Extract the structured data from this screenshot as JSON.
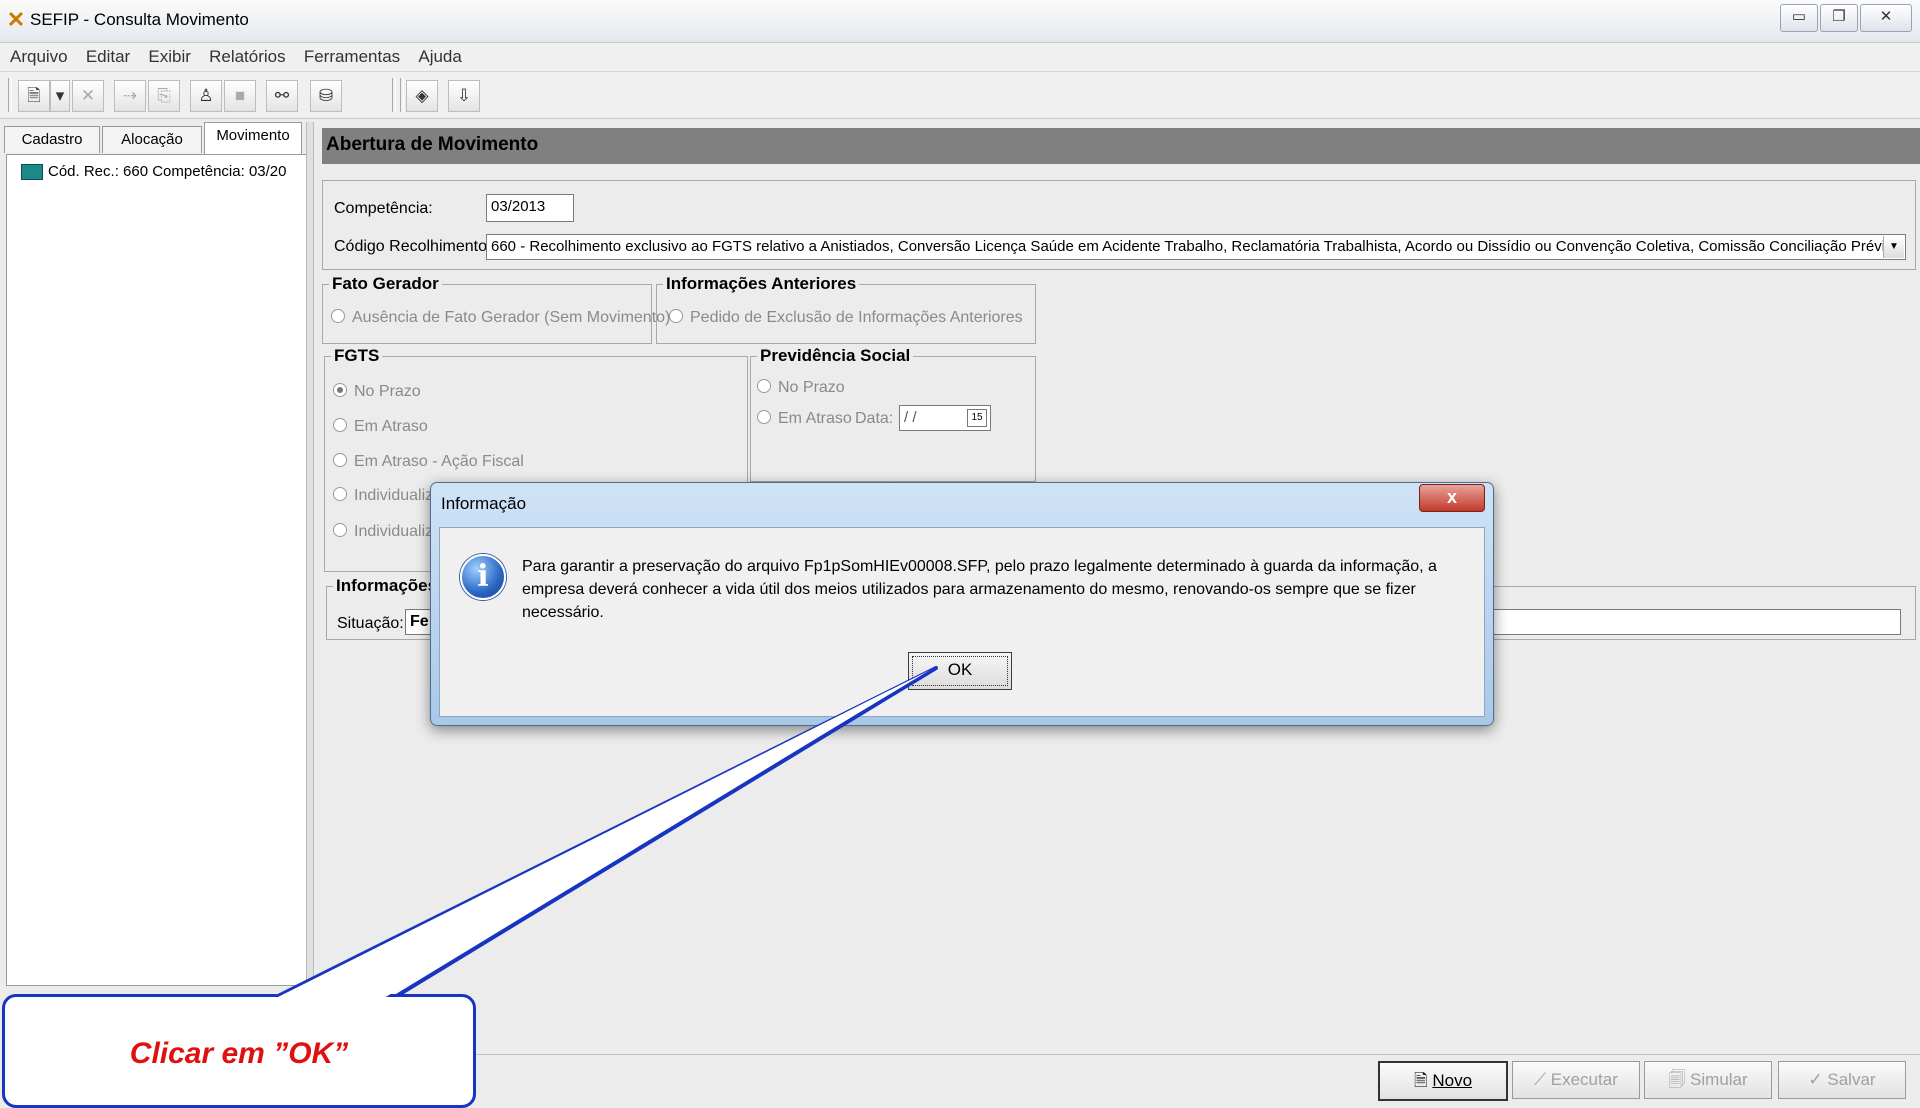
{
  "window": {
    "title": "SEFIP - Consulta Movimento",
    "controls": [
      "minimize-icon",
      "restore-icon",
      "close-icon"
    ]
  },
  "menu": [
    "Arquivo",
    "Editar",
    "Exibir",
    "Relatórios",
    "Ferramentas",
    "Ajuda"
  ],
  "toolbar": {
    "icons": [
      "new-document-icon",
      "dropdown-arrow-icon",
      "delete-icon",
      "move-icon",
      "copy-icon",
      "tree-icon",
      "stop-icon",
      "binoculars-icon",
      "database-icon",
      "report-icon",
      "exit-icon"
    ]
  },
  "left_panel": {
    "tabs": [
      "Cadastro",
      "Alocação",
      "Movimento"
    ],
    "active_tab": "Movimento",
    "tree_item": "Cód. Rec.: 660 Competência: 03/20"
  },
  "main": {
    "header": "Abertura de Movimento",
    "competencia_label": "Competência:",
    "competencia_value": "03/2013",
    "codigo_label": "Código Recolhimento:",
    "codigo_value": "660 - Recolhimento exclusivo ao FGTS relativo a Anistiados, Conversão Licença Saúde em Acidente Trabalho, Reclamatória Trabalhista, Acordo ou Dissídio ou Convenção Coletiva, Comissão Conciliação Prévi",
    "fato_gerador": {
      "title": "Fato Gerador",
      "option": "Ausência de Fato Gerador (Sem Movimento)"
    },
    "info_anteriores": {
      "title": "Informações Anteriores",
      "option": "Pedido de Exclusão de Informações Anteriores"
    },
    "fgts": {
      "title": "FGTS",
      "options": [
        "No Prazo",
        "Em Atraso",
        "Em Atraso - Ação Fiscal",
        "Individualiz",
        "Individualiz"
      ],
      "selected": "No Prazo"
    },
    "previdencia": {
      "title": "Previdência Social",
      "options": [
        "No Prazo",
        "Em Atraso"
      ],
      "data_label": "Data:",
      "data_value": " / /",
      "calendar_label": "15"
    },
    "informacoes": {
      "title": "Informações",
      "situacao_label": "Situação:",
      "situacao_value": "Fe"
    }
  },
  "buttons": {
    "novo": "Novo",
    "executar": "Executar",
    "simular": "Simular",
    "salvar": "Salvar"
  },
  "dialog": {
    "title": "Informação",
    "close": "x",
    "message": "Para garantir a preservação do arquivo Fp1pSomHIEv00008.SFP, pelo prazo legalmente determinado à guarda da informação, a empresa deverá conhecer a vida útil dos meios utilizados para armazenamento do mesmo, renovando-os sempre que se fizer necessário.",
    "icon_glyph": "i",
    "ok": "OK"
  },
  "callout": {
    "text": "Clicar em ”OK”"
  },
  "colors": {
    "header_bg": "#808080",
    "callout_border": "#1734c2",
    "callout_text": "#e01010"
  }
}
